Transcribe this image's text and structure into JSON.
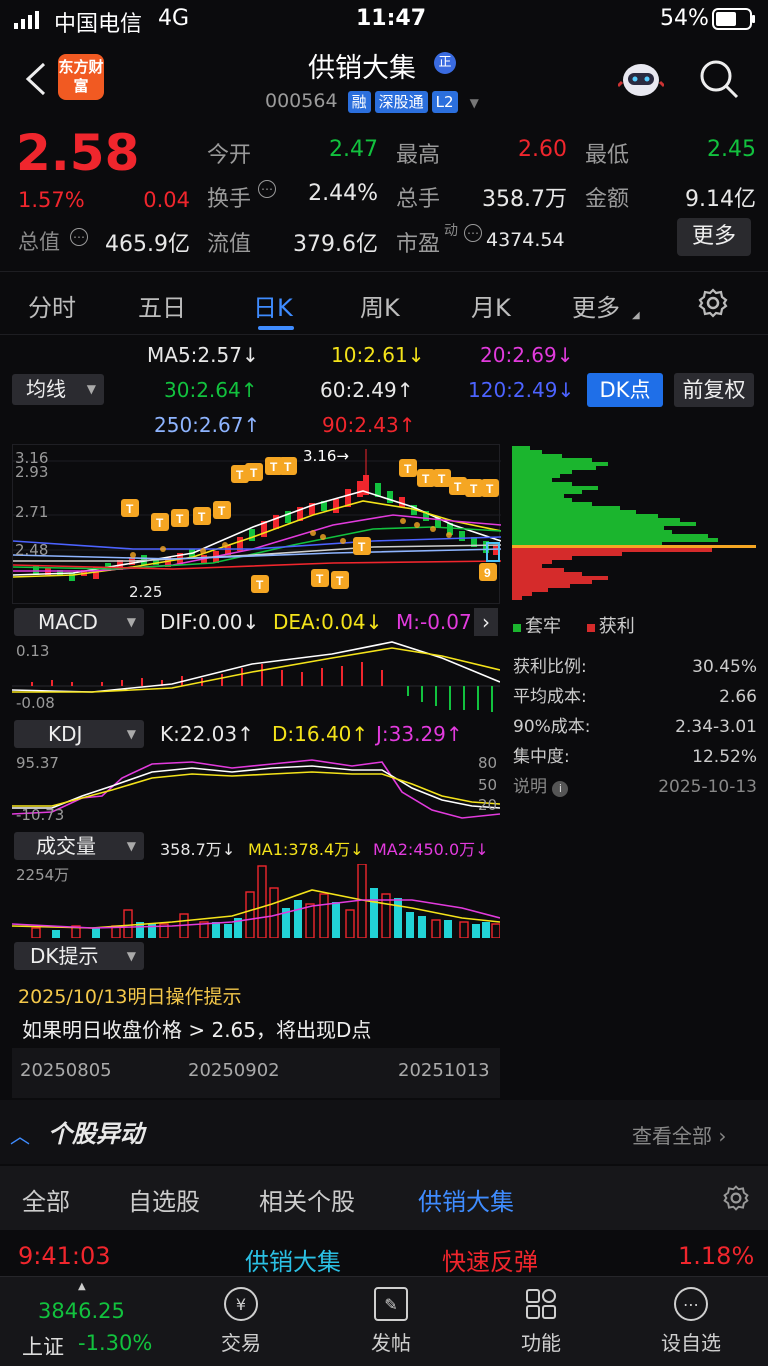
{
  "status_bar": {
    "signal": "中国电信",
    "network": "4G",
    "time": "11:47",
    "battery": "54%"
  },
  "header": {
    "logo": "东方财富",
    "stock_name": "供销大集",
    "badge": "正",
    "code": "000564",
    "tags": [
      "融",
      "深股通",
      "L2"
    ]
  },
  "quote": {
    "price": "2.58",
    "change_pct": "1.57%",
    "change": "0.04",
    "total_value_label": "总值",
    "total_value": "465.9亿",
    "open_label": "今开",
    "open": "2.47",
    "high_label": "最高",
    "high": "2.60",
    "low_label": "最低",
    "low": "2.45",
    "turnover_label": "换手",
    "turnover": "2.44%",
    "volume_label": "总手",
    "volume": "358.7万",
    "amount_label": "金额",
    "amount": "9.14亿",
    "float_label": "流值",
    "float_value": "379.6亿",
    "pe_label": "市盈",
    "pe_sup": "动",
    "pe": "4374.54",
    "more": "更多"
  },
  "tabs": [
    {
      "label": "分时"
    },
    {
      "label": "五日"
    },
    {
      "label": "日K",
      "active": true
    },
    {
      "label": "周K"
    },
    {
      "label": "月K"
    },
    {
      "label": "更多"
    }
  ],
  "ma": {
    "select": "均线",
    "ma5": "MA5:2.57",
    "ma10": "10:2.61",
    "ma20": "20:2.69",
    "ma30": "30:2.64",
    "ma60": "60:2.49",
    "ma120": "120:2.49",
    "ma250": "250:2.67",
    "ma90": "90:2.43",
    "dk_button": "DK点",
    "fq_button": "前复权"
  },
  "kline": {
    "y_labels": [
      "3.16",
      "2.93",
      "2.71",
      "2.48",
      "2.25"
    ],
    "max_label": "3.16",
    "min_label": "2.25",
    "x_labels": [
      "20250805",
      "20250902",
      "20251013"
    ]
  },
  "chip": {
    "legend_trapped": "套牢",
    "legend_profit": "获利",
    "rows": [
      {
        "label": "获利比例:",
        "value": "30.45%"
      },
      {
        "label": "平均成本:",
        "value": "2.66"
      },
      {
        "label": "90%成本:",
        "value": "2.34-3.01"
      },
      {
        "label": "集中度:",
        "value": "12.52%"
      }
    ],
    "note": "说明",
    "date": "2025-10-13"
  },
  "macd": {
    "select": "MACD",
    "dif": "DIF:0.00",
    "dea": "DEA:0.04",
    "m": "M:-0.07",
    "y_top": "0.13",
    "y_bottom": "-0.08"
  },
  "kdj": {
    "select": "KDJ",
    "k": "K:22.03",
    "d": "D:16.40",
    "j": "J:33.29",
    "y_top": "95.37",
    "y_bottom": "-10.73",
    "r80": "80",
    "r50": "50",
    "r20": "20"
  },
  "volume": {
    "select": "成交量",
    "vol": "358.7万",
    "ma1": "MA1:378.4万",
    "ma2": "MA2:450.0万",
    "y_top": "2254万"
  },
  "dk_tip": {
    "select": "DK提示",
    "title": "2025/10/13明日操作提示",
    "text": "如果明日收盘价格 > 2.65，将出现D点"
  },
  "news": {
    "title": "个股异动",
    "view_all": "查看全部",
    "tabs": [
      "全部",
      "自选股",
      "相关个股",
      "供销大集"
    ],
    "row": {
      "time": "9:41:03",
      "name": "供销大集",
      "event": "快速反弹",
      "pct": "1.18%"
    }
  },
  "bottom_nav": {
    "index_value": "3846.25",
    "index_name": "上证",
    "index_change": "-1.30%",
    "items": [
      "交易",
      "发帖",
      "功能",
      "设自选"
    ]
  }
}
